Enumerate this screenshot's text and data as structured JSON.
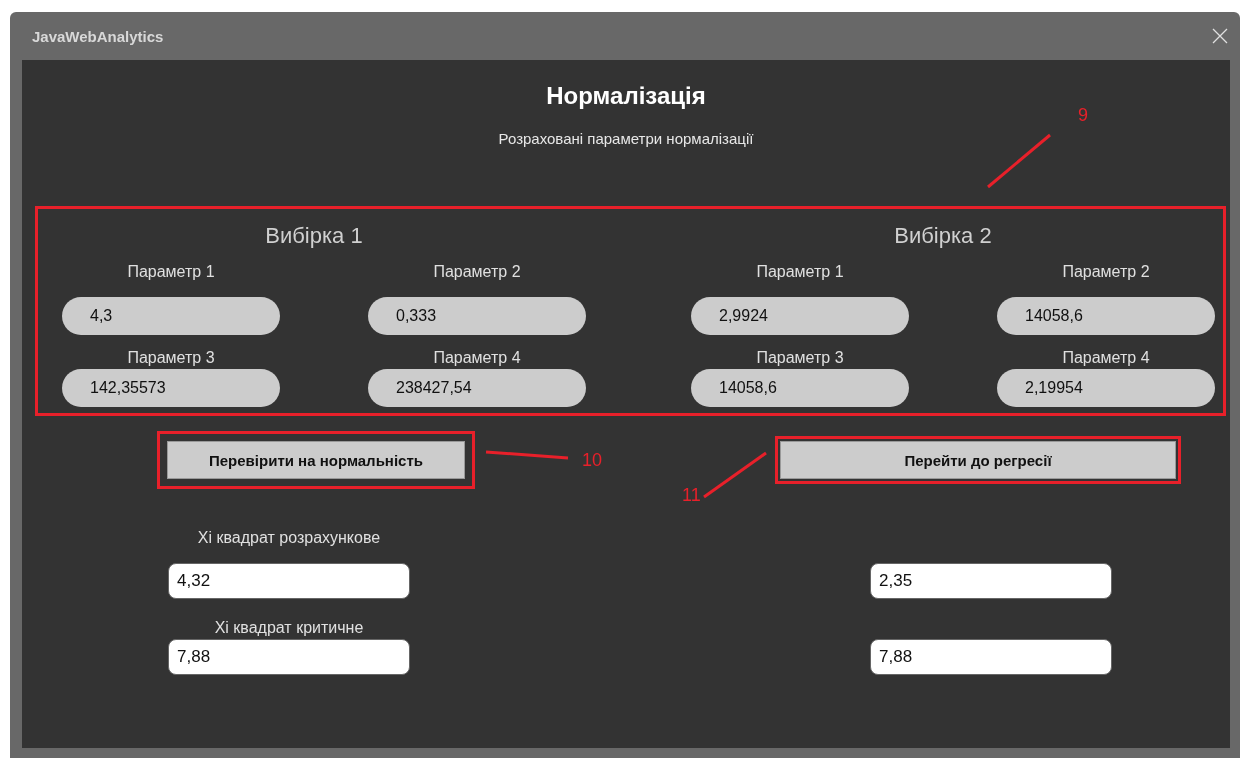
{
  "window": {
    "title": "JavaWebAnalytics"
  },
  "heading": "Нормалізація",
  "subtitle": "Розраховані параметри нормалізації",
  "samples_panel": {
    "annotation": "9",
    "samples": [
      {
        "title": "Вибірка 1",
        "params": [
          {
            "label": "Параметр 1",
            "value": "4,3"
          },
          {
            "label": "Параметр 2",
            "value": "0,333"
          },
          {
            "label": "Параметр 3",
            "value": "142,35573"
          },
          {
            "label": "Параметр 4",
            "value": "238427,54"
          }
        ]
      },
      {
        "title": "Вибірка 2",
        "params": [
          {
            "label": "Параметр 1",
            "value": "2,9924"
          },
          {
            "label": "Параметр 2",
            "value": "14058,6"
          },
          {
            "label": "Параметр 3",
            "value": "14058,6"
          },
          {
            "label": "Параметр 4",
            "value": "2,19954"
          }
        ]
      }
    ]
  },
  "buttons": [
    {
      "label": "Перевірити на нормальність",
      "annotation": "10"
    },
    {
      "label": "Перейти до регресії",
      "annotation": "11"
    }
  ],
  "chi_square": [
    {
      "label": "Хі квадрат розрахункове",
      "values": [
        "4,32",
        "2,35"
      ]
    },
    {
      "label": "Хі квадрат критичне",
      "values": [
        "7,88",
        "7,88"
      ]
    }
  ]
}
